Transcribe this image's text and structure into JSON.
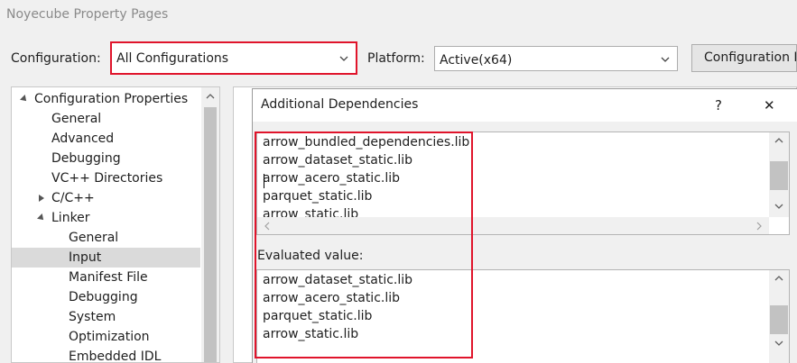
{
  "window": {
    "title": "Noyecube Property Pages"
  },
  "toolbar": {
    "configuration_label": "Configuration:",
    "configuration_value": "All Configurations",
    "platform_label": "Platform:",
    "platform_value": "Active(x64)",
    "config_manager_label": "Configuration Manager..."
  },
  "tree": {
    "items": [
      {
        "label": "Configuration Properties"
      },
      {
        "label": "General"
      },
      {
        "label": "Advanced"
      },
      {
        "label": "Debugging"
      },
      {
        "label": "VC++ Directories"
      },
      {
        "label": "C/C++"
      },
      {
        "label": "Linker"
      },
      {
        "label": "General"
      },
      {
        "label": "Input"
      },
      {
        "label": "Manifest File"
      },
      {
        "label": "Debugging"
      },
      {
        "label": "System"
      },
      {
        "label": "Optimization"
      },
      {
        "label": "Embedded IDL"
      }
    ],
    "selected": "Input"
  },
  "dialog": {
    "title": "Additional Dependencies",
    "help_glyph": "?",
    "close_glyph": "✕",
    "dependencies": [
      "arrow_bundled_dependencies.lib",
      "arrow_dataset_static.lib",
      "arrow_acero_static.lib",
      "parquet_static.lib",
      "arrow_static.lib"
    ],
    "evaluated_label": "Evaluated value:",
    "evaluated": [
      "arrow_dataset_static.lib",
      "arrow_acero_static.lib",
      "parquet_static.lib",
      "arrow_static.lib"
    ]
  },
  "colors": {
    "highlight": "#e0142b",
    "selection": "#dadada"
  }
}
